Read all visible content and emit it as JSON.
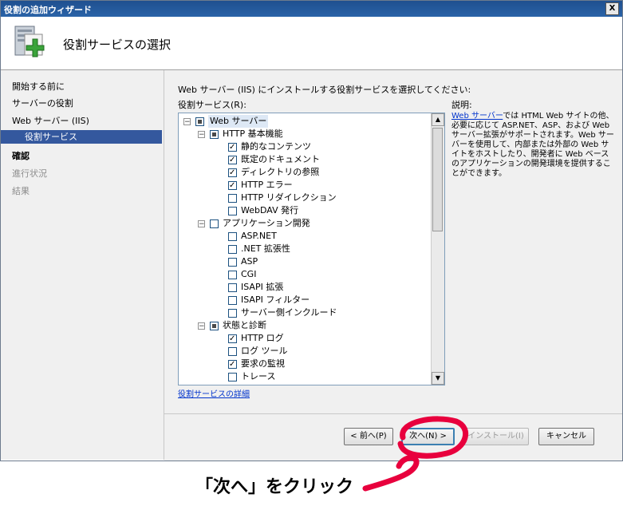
{
  "window": {
    "title": "役割の追加ウィザード",
    "close_glyph": "X"
  },
  "header": {
    "title": "役割サービスの選択",
    "icon": "server-add-icon"
  },
  "nav": {
    "items": [
      {
        "label": "開始する前に",
        "state": "normal"
      },
      {
        "label": "サーバーの役割",
        "state": "normal"
      },
      {
        "label": "Web サーバー (IIS)",
        "state": "normal"
      },
      {
        "label": "役割サービス",
        "state": "selected"
      },
      {
        "label": "確認",
        "state": "bold"
      },
      {
        "label": "進行状況",
        "state": "disabled"
      },
      {
        "label": "結果",
        "state": "disabled"
      }
    ]
  },
  "main": {
    "instruction": "Web サーバー (IIS) にインストールする役割サービスを選択してください:",
    "list_label": "役割サービス(R):",
    "description_label": "説明:",
    "description_link": "Web サーバー",
    "description_text": "では HTML Web サイトの他、必要に応じて ASP.NET、ASP、および Web サーバー拡張がサポートされます。Web サーバーを使用して、内部または外部の Web サイトをホストしたり、開発者に Web ベースのアプリケーションの開発環境を提供することができます。",
    "more_link": "役割サービスの詳細"
  },
  "tree": {
    "items": [
      {
        "label": "Web サーバー",
        "level": 0,
        "expander": "⊟",
        "state": "partial",
        "highlight": true
      },
      {
        "label": "HTTP 基本機能",
        "level": 1,
        "expander": "⊟",
        "state": "partial"
      },
      {
        "label": "静的なコンテンツ",
        "level": 2,
        "state": "checked"
      },
      {
        "label": "既定のドキュメント",
        "level": 2,
        "state": "checked"
      },
      {
        "label": "ディレクトリの参照",
        "level": 2,
        "state": "checked"
      },
      {
        "label": "HTTP エラー",
        "level": 2,
        "state": "checked"
      },
      {
        "label": "HTTP リダイレクション",
        "level": 2,
        "state": "unchecked"
      },
      {
        "label": "WebDAV 発行",
        "level": 2,
        "state": "unchecked"
      },
      {
        "label": "アプリケーション開発",
        "level": 1,
        "expander": "⊟",
        "state": "unchecked"
      },
      {
        "label": "ASP.NET",
        "level": 2,
        "state": "unchecked"
      },
      {
        "label": ".NET 拡張性",
        "level": 2,
        "state": "unchecked"
      },
      {
        "label": "ASP",
        "level": 2,
        "state": "unchecked"
      },
      {
        "label": "CGI",
        "level": 2,
        "state": "unchecked"
      },
      {
        "label": "ISAPI 拡張",
        "level": 2,
        "state": "unchecked"
      },
      {
        "label": "ISAPI フィルター",
        "level": 2,
        "state": "unchecked"
      },
      {
        "label": "サーバー側インクルード",
        "level": 2,
        "state": "unchecked"
      },
      {
        "label": "状態と診断",
        "level": 1,
        "expander": "⊟",
        "state": "partial"
      },
      {
        "label": "HTTP ログ",
        "level": 2,
        "state": "checked"
      },
      {
        "label": "ログ ツール",
        "level": 2,
        "state": "unchecked"
      },
      {
        "label": "要求の監視",
        "level": 2,
        "state": "checked"
      },
      {
        "label": "トレース",
        "level": 2,
        "state": "unchecked"
      }
    ]
  },
  "buttons": {
    "prev": "< 前へ(P)",
    "next": "次へ(N) >",
    "install": "インストール(I)",
    "cancel": "キャンセル"
  },
  "caption": "「次へ」をクリック",
  "colors": {
    "annotation": "#e8003d",
    "selection": "#34589e",
    "titlebar": "#2a63a8",
    "link": "#0033cc"
  }
}
